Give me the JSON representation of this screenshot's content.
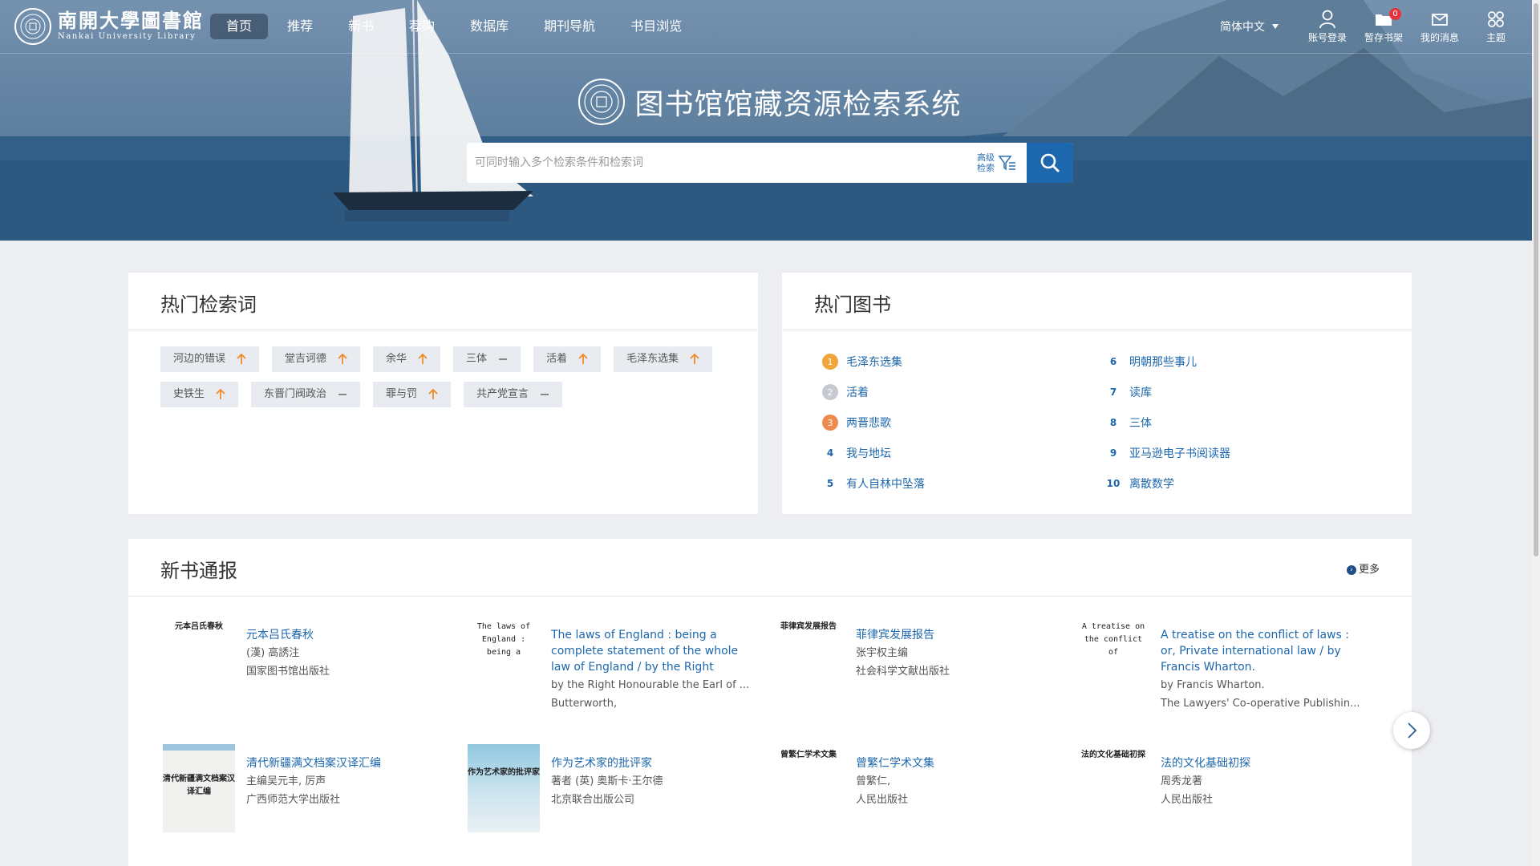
{
  "header": {
    "logo_cn": "南開大學圖書館",
    "logo_en": "Nankai University Library",
    "nav": [
      "首页",
      "推荐",
      "新书",
      "荐购",
      "数据库",
      "期刊导航",
      "书目浏览"
    ],
    "language": "简体中文",
    "tools": [
      {
        "label": "账号登录",
        "icon": "user-icon"
      },
      {
        "label": "暂存书架",
        "icon": "folder-icon",
        "badge": "0"
      },
      {
        "label": "我的消息",
        "icon": "mail-icon"
      },
      {
        "label": "主题",
        "icon": "theme-icon"
      }
    ]
  },
  "hero": {
    "title": "图书馆馆藏资源检索系统",
    "search_placeholder": "可同时输入多个检索条件和检索词",
    "advanced_label": "高级检索"
  },
  "hot_terms": {
    "title": "热门检索词",
    "items": [
      {
        "label": "河边的错误",
        "trend": "up"
      },
      {
        "label": "堂吉诃德",
        "trend": "up"
      },
      {
        "label": "余华",
        "trend": "up"
      },
      {
        "label": "三体",
        "trend": "flat"
      },
      {
        "label": "活着",
        "trend": "up"
      },
      {
        "label": "毛泽东选集",
        "trend": "up"
      },
      {
        "label": "史铁生",
        "trend": "up"
      },
      {
        "label": "东晋门阀政治",
        "trend": "flat"
      },
      {
        "label": "罪与罚",
        "trend": "up"
      },
      {
        "label": "共产党宣言",
        "trend": "flat"
      }
    ]
  },
  "hot_books": {
    "title": "热门图书",
    "colors": {
      "rank1": "#f0a43a",
      "rank2": "#c6c9d0",
      "rank3": "#ef8a4e"
    },
    "items": [
      {
        "rank": "1",
        "title": "毛泽东选集"
      },
      {
        "rank": "2",
        "title": "活着"
      },
      {
        "rank": "3",
        "title": "两晋悲歌"
      },
      {
        "rank": "4",
        "title": "我与地坛"
      },
      {
        "rank": "5",
        "title": "有人自林中坠落"
      },
      {
        "rank": "6",
        "title": "明朝那些事儿"
      },
      {
        "rank": "7",
        "title": "读库"
      },
      {
        "rank": "8",
        "title": "三体"
      },
      {
        "rank": "9",
        "title": "亚马逊电子书阅读器"
      },
      {
        "rank": "10",
        "title": "离散数学"
      }
    ]
  },
  "new_books": {
    "title": "新书通报",
    "more_label": "更多",
    "items": [
      {
        "cover_text": "元本吕氏春秋",
        "title": "元本吕氏春秋",
        "author": "(漢) 高誘注",
        "publisher": "国家图书馆出版社"
      },
      {
        "cover_text": "The laws of England : being a",
        "title": "The laws of England : being a complete statement of the whole law of England / by the Right Honourable th...",
        "author": "by the Right Honourable the Earl of ...",
        "publisher": "Butterworth,"
      },
      {
        "cover_text": "菲律宾发展报告",
        "title": "菲律宾发展报告",
        "author": "张宇权主编",
        "publisher": "社会科学文献出版社"
      },
      {
        "cover_text": "A treatise on the conflict of",
        "title": "A treatise on the conflict of laws : or, Private international law / by Francis Wharton.",
        "author": "by Francis Wharton.",
        "publisher": "The Lawyers' Co-operative Publishin..."
      },
      {
        "cover_text": "清代新疆满文档案汉译汇编",
        "title": "清代新疆满文档案汉译汇编",
        "author": "主编吴元丰, 厉声",
        "publisher": "广西师范大学出版社"
      },
      {
        "cover_text": "作为艺术家的批评家",
        "title": "作为艺术家的批评家",
        "author": "著者 (英) 奥斯卡·王尔德",
        "publisher": "北京联合出版公司"
      },
      {
        "cover_text": "曾繁仁学术文集",
        "title": "曾繁仁学术文集",
        "author": "曾繁仁,",
        "publisher": "人民出版社"
      },
      {
        "cover_text": "法的文化基础初探",
        "title": "法的文化基础初探",
        "author": "周秀龙著",
        "publisher": "人民出版社"
      }
    ]
  }
}
